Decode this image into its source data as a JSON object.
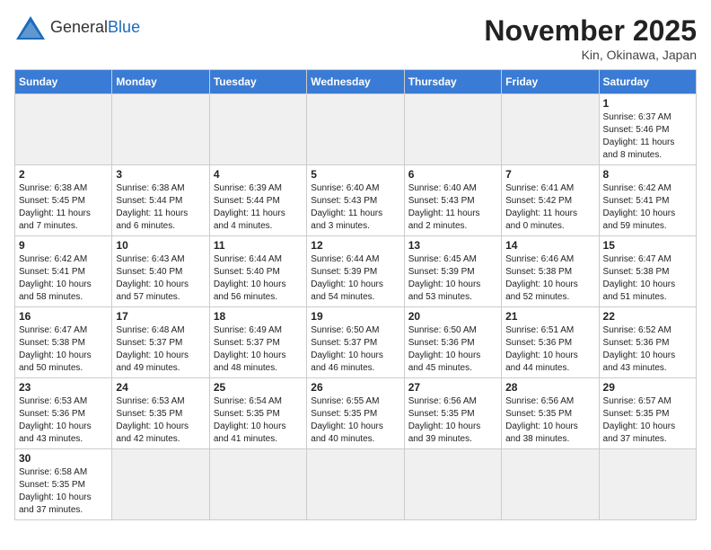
{
  "header": {
    "title": "November 2025",
    "location": "Kin, Okinawa, Japan",
    "logo_general": "General",
    "logo_blue": "Blue"
  },
  "days_of_week": [
    "Sunday",
    "Monday",
    "Tuesday",
    "Wednesday",
    "Thursday",
    "Friday",
    "Saturday"
  ],
  "weeks": [
    [
      {
        "day": "",
        "info": ""
      },
      {
        "day": "",
        "info": ""
      },
      {
        "day": "",
        "info": ""
      },
      {
        "day": "",
        "info": ""
      },
      {
        "day": "",
        "info": ""
      },
      {
        "day": "",
        "info": ""
      },
      {
        "day": "1",
        "info": "Sunrise: 6:37 AM\nSunset: 5:46 PM\nDaylight: 11 hours\nand 8 minutes."
      }
    ],
    [
      {
        "day": "2",
        "info": "Sunrise: 6:38 AM\nSunset: 5:45 PM\nDaylight: 11 hours\nand 7 minutes."
      },
      {
        "day": "3",
        "info": "Sunrise: 6:38 AM\nSunset: 5:44 PM\nDaylight: 11 hours\nand 6 minutes."
      },
      {
        "day": "4",
        "info": "Sunrise: 6:39 AM\nSunset: 5:44 PM\nDaylight: 11 hours\nand 4 minutes."
      },
      {
        "day": "5",
        "info": "Sunrise: 6:40 AM\nSunset: 5:43 PM\nDaylight: 11 hours\nand 3 minutes."
      },
      {
        "day": "6",
        "info": "Sunrise: 6:40 AM\nSunset: 5:43 PM\nDaylight: 11 hours\nand 2 minutes."
      },
      {
        "day": "7",
        "info": "Sunrise: 6:41 AM\nSunset: 5:42 PM\nDaylight: 11 hours\nand 0 minutes."
      },
      {
        "day": "8",
        "info": "Sunrise: 6:42 AM\nSunset: 5:41 PM\nDaylight: 10 hours\nand 59 minutes."
      }
    ],
    [
      {
        "day": "9",
        "info": "Sunrise: 6:42 AM\nSunset: 5:41 PM\nDaylight: 10 hours\nand 58 minutes."
      },
      {
        "day": "10",
        "info": "Sunrise: 6:43 AM\nSunset: 5:40 PM\nDaylight: 10 hours\nand 57 minutes."
      },
      {
        "day": "11",
        "info": "Sunrise: 6:44 AM\nSunset: 5:40 PM\nDaylight: 10 hours\nand 56 minutes."
      },
      {
        "day": "12",
        "info": "Sunrise: 6:44 AM\nSunset: 5:39 PM\nDaylight: 10 hours\nand 54 minutes."
      },
      {
        "day": "13",
        "info": "Sunrise: 6:45 AM\nSunset: 5:39 PM\nDaylight: 10 hours\nand 53 minutes."
      },
      {
        "day": "14",
        "info": "Sunrise: 6:46 AM\nSunset: 5:38 PM\nDaylight: 10 hours\nand 52 minutes."
      },
      {
        "day": "15",
        "info": "Sunrise: 6:47 AM\nSunset: 5:38 PM\nDaylight: 10 hours\nand 51 minutes."
      }
    ],
    [
      {
        "day": "16",
        "info": "Sunrise: 6:47 AM\nSunset: 5:38 PM\nDaylight: 10 hours\nand 50 minutes."
      },
      {
        "day": "17",
        "info": "Sunrise: 6:48 AM\nSunset: 5:37 PM\nDaylight: 10 hours\nand 49 minutes."
      },
      {
        "day": "18",
        "info": "Sunrise: 6:49 AM\nSunset: 5:37 PM\nDaylight: 10 hours\nand 48 minutes."
      },
      {
        "day": "19",
        "info": "Sunrise: 6:50 AM\nSunset: 5:37 PM\nDaylight: 10 hours\nand 46 minutes."
      },
      {
        "day": "20",
        "info": "Sunrise: 6:50 AM\nSunset: 5:36 PM\nDaylight: 10 hours\nand 45 minutes."
      },
      {
        "day": "21",
        "info": "Sunrise: 6:51 AM\nSunset: 5:36 PM\nDaylight: 10 hours\nand 44 minutes."
      },
      {
        "day": "22",
        "info": "Sunrise: 6:52 AM\nSunset: 5:36 PM\nDaylight: 10 hours\nand 43 minutes."
      }
    ],
    [
      {
        "day": "23",
        "info": "Sunrise: 6:53 AM\nSunset: 5:36 PM\nDaylight: 10 hours\nand 43 minutes."
      },
      {
        "day": "24",
        "info": "Sunrise: 6:53 AM\nSunset: 5:35 PM\nDaylight: 10 hours\nand 42 minutes."
      },
      {
        "day": "25",
        "info": "Sunrise: 6:54 AM\nSunset: 5:35 PM\nDaylight: 10 hours\nand 41 minutes."
      },
      {
        "day": "26",
        "info": "Sunrise: 6:55 AM\nSunset: 5:35 PM\nDaylight: 10 hours\nand 40 minutes."
      },
      {
        "day": "27",
        "info": "Sunrise: 6:56 AM\nSunset: 5:35 PM\nDaylight: 10 hours\nand 39 minutes."
      },
      {
        "day": "28",
        "info": "Sunrise: 6:56 AM\nSunset: 5:35 PM\nDaylight: 10 hours\nand 38 minutes."
      },
      {
        "day": "29",
        "info": "Sunrise: 6:57 AM\nSunset: 5:35 PM\nDaylight: 10 hours\nand 37 minutes."
      }
    ],
    [
      {
        "day": "30",
        "info": "Sunrise: 6:58 AM\nSunset: 5:35 PM\nDaylight: 10 hours\nand 37 minutes."
      },
      {
        "day": "",
        "info": ""
      },
      {
        "day": "",
        "info": ""
      },
      {
        "day": "",
        "info": ""
      },
      {
        "day": "",
        "info": ""
      },
      {
        "day": "",
        "info": ""
      },
      {
        "day": "",
        "info": ""
      }
    ]
  ]
}
